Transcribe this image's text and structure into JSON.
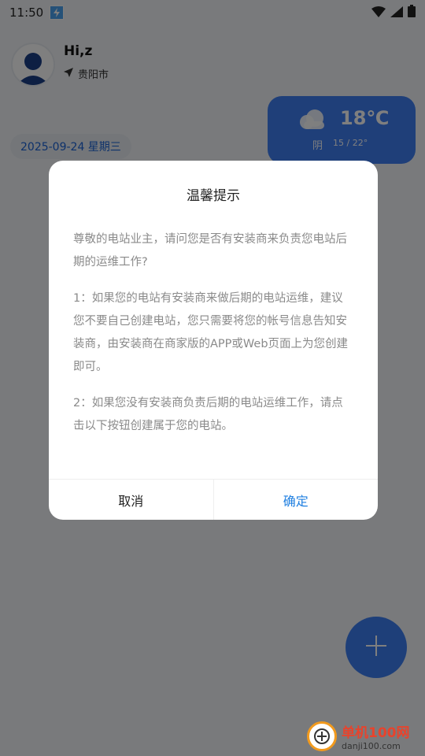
{
  "status_bar": {
    "time": "11:50"
  },
  "header": {
    "greeting": "Hi,z",
    "location": "贵阳市"
  },
  "weather": {
    "temperature": "18℃",
    "condition": "阴",
    "range": "15 / 22°"
  },
  "date_label": "2025-09-24 星期三",
  "dialog": {
    "title": "温馨提示",
    "paragraphs": [
      "尊敬的电站业主，请问您是否有安装商来负责您电站后期的运维工作?",
      "1：如果您的电站有安装商来做后期的电站运维，建议您不要自己创建电站，您只需要将您的帐号信息告知安装商，由安装商在商家版的APP或Web页面上为您创建即可。",
      "2：如果您没有安装商负责后期的电站运维工作，请点击以下按钮创建属于您的电站。"
    ],
    "cancel_label": "取消",
    "confirm_label": "确定"
  },
  "watermark": {
    "title": "单机100网",
    "url": "danji100.com"
  },
  "colors": {
    "accent": "#3c7ef2",
    "confirm": "#1f7fe0"
  }
}
